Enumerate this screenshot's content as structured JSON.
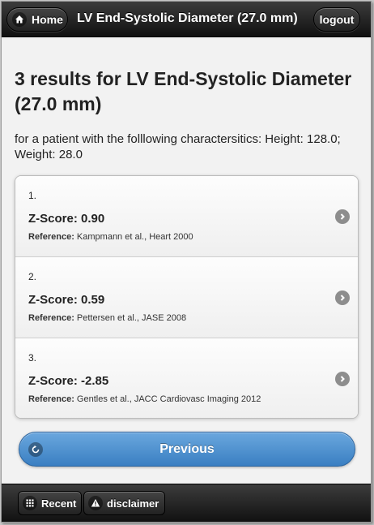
{
  "header": {
    "home_label": "Home",
    "title": "LV End-Systolic Diameter (27.0 mm)",
    "logout_label": "logout"
  },
  "main": {
    "heading": "3 results for LV End-Systolic Diameter (27.0 mm)",
    "subtext": "for a patient with the folllowing charactersitics: Height: 128.0; Weight: 28.0",
    "results": [
      {
        "number": "1.",
        "score": "Z-Score: 0.90",
        "ref_label": "Reference:",
        "ref_text": "Kampmann et al., Heart 2000"
      },
      {
        "number": "2.",
        "score": "Z-Score: 0.59",
        "ref_label": "Reference:",
        "ref_text": "Pettersen et al., JASE 2008"
      },
      {
        "number": "3.",
        "score": "Z-Score: -2.85",
        "ref_label": "Reference:",
        "ref_text": "Gentles et al., JACC Cardiovasc Imaging 2012"
      }
    ],
    "previous_label": "Previous"
  },
  "footer": {
    "recent_label": "Recent",
    "disclaimer_label": "disclaimer"
  },
  "colors": {
    "bar_dark": "#1e1e1e",
    "accent_blue": "#4a8fd0",
    "background": "#f2f2f2"
  },
  "icons": {
    "home": "home-icon",
    "previous": "back-arrow-icon",
    "result_chevron": "chevron-right-icon",
    "recent": "grid-icon",
    "disclaimer": "warning-icon"
  }
}
